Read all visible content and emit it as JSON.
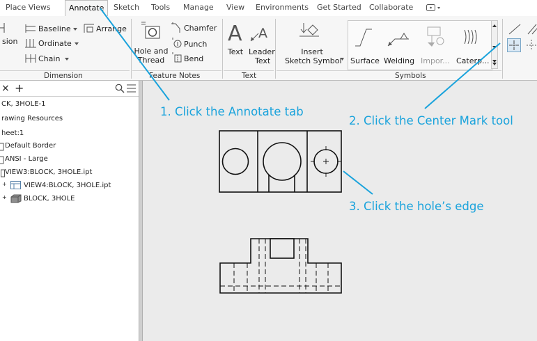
{
  "tabs": [
    "Place Views",
    "Annotate",
    "Sketch",
    "Tools",
    "Manage",
    "View",
    "Environments",
    "Get Started",
    "Collaborate"
  ],
  "active_tab": "Annotate",
  "ribbon": {
    "dimension": {
      "partial_label": "sion",
      "baseline": "Baseline",
      "arrange": "Arrange",
      "ordinate": "Ordinate",
      "chain": "Chain",
      "panel_label": "Dimension"
    },
    "feature_notes": {
      "hole_and_thread_1": "Hole and",
      "hole_and_thread_2": "Thread",
      "chamfer": "Chamfer",
      "punch": "Punch",
      "bend": "Bend",
      "panel_label": "Feature Notes"
    },
    "text": {
      "text": "Text",
      "leader_text_1": "Leader",
      "leader_text_2": "Text",
      "panel_label": "Text"
    },
    "symbols": {
      "insert_1": "Insert",
      "insert_2": "Sketch Symbol",
      "surface": "Surface",
      "welding": "Welding",
      "import": "Impor...",
      "caterpillar": "Caterp...",
      "panel_label": "Symbols"
    }
  },
  "browser": {
    "items": [
      "CK, 3HOLE-1",
      "rawing Resources",
      "heet:1",
      "Default Border",
      "ANSI - Large",
      "VIEW3:BLOCK, 3HOLE.ipt",
      "VIEW4:BLOCK, 3HOLE.ipt",
      "BLOCK, 3HOLE"
    ]
  },
  "callouts": {
    "step1": "1. Click the Annotate tab",
    "step2": "2. Click the Center Mark tool",
    "step3": "3. Click the hole’s edge"
  },
  "colors": {
    "callout": "#1aa3dc",
    "ribbon_bg": "#f6f6f6",
    "canvas_bg": "#ebebeb"
  }
}
